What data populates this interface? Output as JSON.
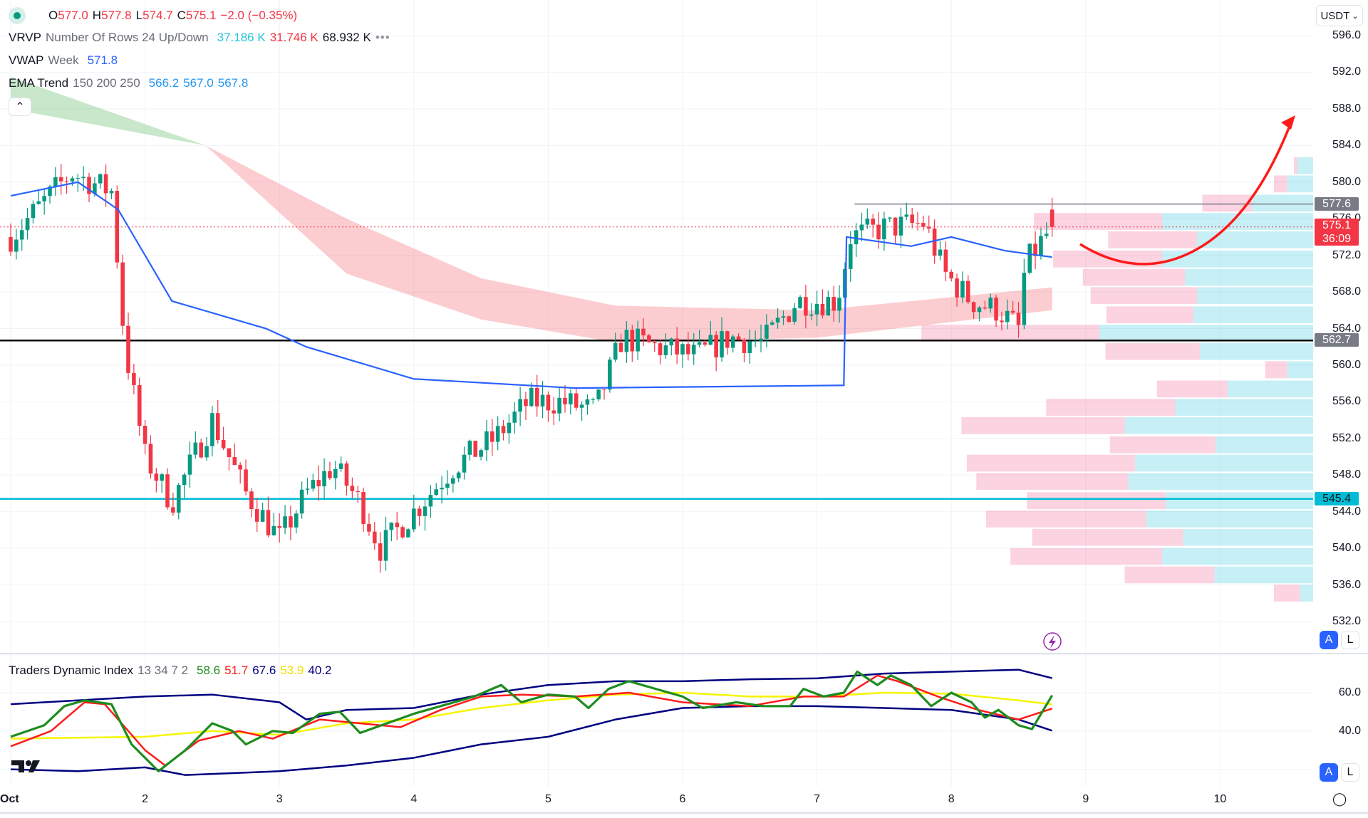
{
  "ohlc_legend": {
    "open_label": "O",
    "open": "577.0",
    "high_label": "H",
    "high": "577.8",
    "low_label": "L",
    "low": "574.7",
    "close_label": "C",
    "close": "575.1",
    "change": "−2.0 (−0.35%)"
  },
  "vrvp": {
    "name": "VRVP",
    "params": "Number Of Rows 24 Up/Down",
    "up": "37.186 K",
    "down": "31.746 K",
    "total": "68.932 K"
  },
  "vwap": {
    "name": "VWAP",
    "params": "Week",
    "value": "571.8"
  },
  "ema": {
    "name": "EMA Trend",
    "params": "150 200 250",
    "v1": "566.2",
    "v2": "567.0",
    "v3": "567.8"
  },
  "tdi": {
    "name": "Traders Dynamic Index",
    "params": "13 34 7 2",
    "rsi": "58.6",
    "signal": "51.7",
    "upper": "67.6",
    "middle": "53.9",
    "lower": "40.2"
  },
  "currency": "USDT",
  "price_axis": [
    "596.0",
    "592.0",
    "588.0",
    "584.0",
    "580.0",
    "576.0",
    "572.0",
    "568.0",
    "564.0",
    "560.0",
    "556.0",
    "552.0",
    "548.0",
    "544.0",
    "540.0",
    "536.0",
    "532.0"
  ],
  "tdi_axis": [
    "60.0",
    "40.0"
  ],
  "x_axis": [
    "Oct",
    "2",
    "3",
    "4",
    "5",
    "6",
    "7",
    "8",
    "9",
    "10"
  ],
  "price_tags": {
    "high_level": "577.6",
    "last": "575.1",
    "countdown": "36:09",
    "support": "562.7",
    "cyan_level": "545.4"
  },
  "auto_label": "A",
  "log_label": "L",
  "colors": {
    "up": "#089981",
    "down": "#f23645",
    "vwap": "#2962ff",
    "cyan_line": "#00bcd4",
    "arrow": "#ff1a1a"
  },
  "chart_data": {
    "type": "candlestick",
    "price_path": [
      [
        0,
        574
      ],
      [
        0.45,
        581
      ],
      [
        0.75,
        579
      ],
      [
        0.85,
        562
      ],
      [
        1,
        550
      ],
      [
        1.2,
        545
      ],
      [
        1.5,
        554
      ],
      [
        1.75,
        546
      ],
      [
        2,
        541
      ],
      [
        2.2,
        546
      ],
      [
        2.4,
        549
      ],
      [
        2.6,
        545
      ],
      [
        2.75,
        540
      ],
      [
        3,
        544
      ],
      [
        3.3,
        549
      ],
      [
        3.6,
        552
      ],
      [
        3.85,
        556
      ],
      [
        4.1,
        556
      ],
      [
        4.35,
        555
      ],
      [
        4.55,
        563
      ],
      [
        4.8,
        562
      ],
      [
        5.1,
        561
      ],
      [
        5.35,
        563
      ],
      [
        5.6,
        562.5
      ],
      [
        5.85,
        567
      ],
      [
        6.15,
        567
      ],
      [
        6.25,
        574
      ],
      [
        6.5,
        575
      ],
      [
        6.8,
        575.5
      ],
      [
        6.95,
        570
      ],
      [
        7.15,
        567
      ],
      [
        7.35,
        566
      ],
      [
        7.5,
        564
      ],
      [
        7.55,
        571
      ],
      [
        7.75,
        575.1
      ]
    ],
    "vwap": [
      [
        0,
        578.5
      ],
      [
        0.5,
        580
      ],
      [
        0.8,
        577
      ],
      [
        1.2,
        567
      ],
      [
        1.9,
        564
      ],
      [
        2.2,
        562
      ],
      [
        3,
        558.5
      ],
      [
        4.2,
        557.5
      ],
      [
        6.2,
        557.8
      ],
      [
        6.22,
        574
      ],
      [
        6.7,
        573
      ],
      [
        7,
        574
      ],
      [
        7.4,
        572.5
      ],
      [
        7.75,
        571.8
      ]
    ],
    "ema_band": [
      [
        0,
        591.5,
        588
      ],
      [
        1.45,
        584,
        584
      ],
      [
        2.5,
        576,
        570
      ],
      [
        3.5,
        569.5,
        565
      ],
      [
        4.5,
        566.5,
        562.5
      ],
      [
        6,
        566,
        563
      ],
      [
        7.75,
        568.5,
        566
      ]
    ],
    "levels": {
      "resistance": 577.6,
      "support": 562.7,
      "cyan": 545.4,
      "last": 575.1
    },
    "volume_profile": {
      "row_size": 2,
      "rows": [
        {
          "price": 581.8,
          "down": 4,
          "up": 18
        },
        {
          "price": 579.8,
          "down": 15,
          "up": 30
        },
        {
          "price": 577.7,
          "down": 57,
          "up": 70
        },
        {
          "price": 575.7,
          "down": 147,
          "up": 173
        },
        {
          "price": 573.7,
          "down": 102,
          "up": 133
        },
        {
          "price": 571.6,
          "down": 125,
          "up": 173
        },
        {
          "price": 569.6,
          "down": 117,
          "up": 147
        },
        {
          "price": 567.6,
          "down": 122,
          "up": 133
        },
        {
          "price": 565.5,
          "down": 100,
          "up": 137
        },
        {
          "price": 563.5,
          "down": 204,
          "up": 245
        },
        {
          "price": 561.5,
          "down": 108,
          "up": 130
        },
        {
          "price": 559.5,
          "down": 25,
          "up": 30
        },
        {
          "price": 557.4,
          "down": 81,
          "up": 98
        },
        {
          "price": 555.4,
          "down": 148,
          "up": 158
        },
        {
          "price": 553.4,
          "down": 187,
          "up": 216
        },
        {
          "price": 551.3,
          "down": 121,
          "up": 112
        },
        {
          "price": 549.3,
          "down": 193,
          "up": 204
        },
        {
          "price": 547.3,
          "down": 174,
          "up": 212
        },
        {
          "price": 545.2,
          "down": 159,
          "up": 169
        },
        {
          "price": 543.2,
          "down": 184,
          "up": 191
        },
        {
          "price": 541.2,
          "down": 173,
          "up": 149
        },
        {
          "price": 539.1,
          "down": 174,
          "up": 173
        },
        {
          "price": 537.1,
          "down": 103,
          "up": 113
        },
        {
          "price": 535.1,
          "down": 30,
          "up": 15
        }
      ]
    },
    "tdi_series": {
      "rsi": [
        [
          0,
          37
        ],
        [
          0.25,
          43
        ],
        [
          0.4,
          53
        ],
        [
          0.55,
          56
        ],
        [
          0.75,
          54
        ],
        [
          0.9,
          33
        ],
        [
          1.1,
          19
        ],
        [
          1.3,
          30
        ],
        [
          1.5,
          44
        ],
        [
          1.65,
          40
        ],
        [
          1.75,
          33
        ],
        [
          1.95,
          40
        ],
        [
          2.1,
          39
        ],
        [
          2.3,
          49
        ],
        [
          2.45,
          50
        ],
        [
          2.6,
          39
        ],
        [
          2.8,
          44
        ],
        [
          3,
          49
        ],
        [
          3.2,
          53
        ],
        [
          3.45,
          58
        ],
        [
          3.65,
          64
        ],
        [
          3.8,
          55
        ],
        [
          4,
          59
        ],
        [
          4.2,
          58
        ],
        [
          4.3,
          52
        ],
        [
          4.45,
          62
        ],
        [
          4.6,
          66
        ],
        [
          4.8,
          62
        ],
        [
          5,
          58
        ],
        [
          5.15,
          52
        ],
        [
          5.4,
          55
        ],
        [
          5.6,
          53
        ],
        [
          5.8,
          53
        ],
        [
          5.9,
          62
        ],
        [
          6.05,
          58
        ],
        [
          6.2,
          60
        ],
        [
          6.3,
          71
        ],
        [
          6.45,
          64
        ],
        [
          6.55,
          69
        ],
        [
          6.7,
          64
        ],
        [
          6.85,
          53
        ],
        [
          7,
          60
        ],
        [
          7.15,
          55
        ],
        [
          7.25,
          47
        ],
        [
          7.35,
          51
        ],
        [
          7.5,
          43
        ],
        [
          7.6,
          41
        ],
        [
          7.75,
          58.6
        ]
      ],
      "signal": [
        [
          0,
          32
        ],
        [
          0.3,
          40
        ],
        [
          0.55,
          55
        ],
        [
          0.7,
          54
        ],
        [
          1,
          30
        ],
        [
          1.15,
          22
        ],
        [
          1.4,
          35
        ],
        [
          1.7,
          40
        ],
        [
          1.95,
          36
        ],
        [
          2.3,
          46
        ],
        [
          2.6,
          44
        ],
        [
          2.9,
          42
        ],
        [
          3.2,
          51
        ],
        [
          3.5,
          58
        ],
        [
          3.8,
          59
        ],
        [
          4.2,
          58
        ],
        [
          4.6,
          60
        ],
        [
          5,
          55
        ],
        [
          5.5,
          53
        ],
        [
          5.9,
          58
        ],
        [
          6.2,
          58
        ],
        [
          6.45,
          69
        ],
        [
          6.6,
          66
        ],
        [
          6.9,
          58
        ],
        [
          7.2,
          51
        ],
        [
          7.5,
          46
        ],
        [
          7.75,
          51.7
        ]
      ],
      "middle": [
        [
          0,
          36
        ],
        [
          1,
          37
        ],
        [
          1.5,
          40
        ],
        [
          2,
          38
        ],
        [
          2.5,
          44
        ],
        [
          3,
          46
        ],
        [
          3.5,
          52
        ],
        [
          4,
          56
        ],
        [
          4.5,
          59
        ],
        [
          5,
          60
        ],
        [
          5.5,
          58
        ],
        [
          6,
          58
        ],
        [
          6.5,
          60
        ],
        [
          7,
          59.5
        ],
        [
          7.5,
          56
        ],
        [
          7.75,
          53.9
        ]
      ],
      "upper": [
        [
          0,
          54
        ],
        [
          0.5,
          56
        ],
        [
          1,
          58
        ],
        [
          1.5,
          59
        ],
        [
          2,
          55
        ],
        [
          2.2,
          46
        ],
        [
          2.5,
          51
        ],
        [
          3,
          52
        ],
        [
          3.5,
          59
        ],
        [
          4,
          64
        ],
        [
          4.5,
          66
        ],
        [
          5,
          66
        ],
        [
          5.5,
          67
        ],
        [
          6,
          67.5
        ],
        [
          6.5,
          70
        ],
        [
          7,
          71
        ],
        [
          7.5,
          72
        ],
        [
          7.75,
          67.6
        ]
      ],
      "lower": [
        [
          0,
          20
        ],
        [
          0.5,
          19
        ],
        [
          1,
          21
        ],
        [
          1.3,
          17
        ],
        [
          2,
          19
        ],
        [
          2.5,
          22
        ],
        [
          3,
          26
        ],
        [
          3.5,
          33
        ],
        [
          4,
          37
        ],
        [
          4.5,
          46
        ],
        [
          5,
          52
        ],
        [
          5.5,
          53
        ],
        [
          6,
          53
        ],
        [
          6.5,
          52
        ],
        [
          7,
          51
        ],
        [
          7.5,
          46
        ],
        [
          7.75,
          40.2
        ]
      ]
    }
  }
}
